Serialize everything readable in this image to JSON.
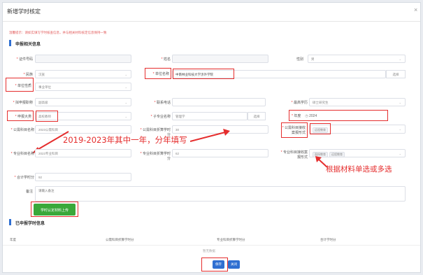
{
  "modal": {
    "title": "新增学时核定",
    "close": "×"
  },
  "notice": "温馨提示：请如实填写学时核查信息，并与相关材料核定信息保持一致",
  "sections": {
    "apply": "申报相关信息",
    "declared": "已申报学时信息"
  },
  "fields": {
    "id_no": {
      "label": "证件号码",
      "value": ""
    },
    "name": {
      "label": "姓名",
      "value": ""
    },
    "gender": {
      "label": "性别",
      "value": "男"
    },
    "ethnic": {
      "label": "民族",
      "value": "汉族"
    },
    "org_name": {
      "label": "单位名称",
      "value": "中南林业科技大学涉外学院",
      "btn": "选择"
    },
    "org_nature": {
      "label": "单位性质",
      "value": "事业单位"
    },
    "title_current": {
      "label": "拟申报职称",
      "value": "副高级"
    },
    "phone": {
      "label": "联系电话",
      "value": ""
    },
    "edu": {
      "label": "最高学历",
      "value": "硕士研究生"
    },
    "series": {
      "label": "申报大类",
      "value": "高校教师"
    },
    "sub_major": {
      "label": "子专业名称",
      "value": "管理学",
      "btn": "选择"
    },
    "year": {
      "label": "年度",
      "value": "2024"
    },
    "public_course": {
      "label": "公需科目名称",
      "value": "2023公需科目"
    },
    "public_hours": {
      "label": "公需科目折算学时分",
      "value": "30"
    },
    "public_form": {
      "label": "公需科目接收案报形式",
      "value": "远程教育"
    },
    "pro_course": {
      "label": "专业科目名称",
      "value": "2023专业科目"
    },
    "pro_hours": {
      "label": "专业科目折算学时分",
      "value": "62"
    },
    "pro_form": {
      "label": "专业科目接收案报形式",
      "chips": [
        "面授教育",
        "远程教育"
      ]
    },
    "total": {
      "label": "合计学时分",
      "value": "92"
    },
    "remark": {
      "label": "备注",
      "placeholder": "请输入备注"
    }
  },
  "upload_btn": "学时认定材料上传",
  "table": {
    "headers": [
      "年度",
      "公需科目折算学时分",
      "专业科目折算学时分",
      "合计学时分"
    ],
    "empty": "暂无数据"
  },
  "buttons": {
    "save": "保存",
    "close": "关闭"
  },
  "annotations": {
    "year_note": "2019-2023年其中一年，分年填写",
    "material_note": "根据材料单选或多选"
  }
}
